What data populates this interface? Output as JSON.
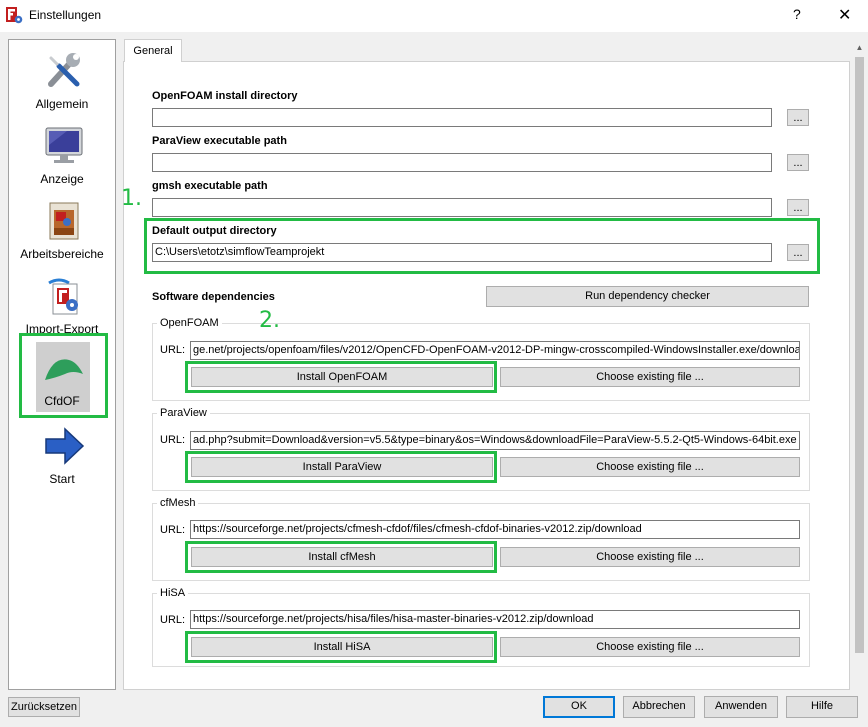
{
  "window": {
    "title": "Einstellungen",
    "help_glyph": "?",
    "close_glyph": "✕"
  },
  "sidebar": {
    "items": [
      {
        "label": "Allgemein",
        "icon": "wrench-screwdriver-icon"
      },
      {
        "label": "Anzeige",
        "icon": "monitor-icon"
      },
      {
        "label": "Arbeitsbereiche",
        "icon": "workbench-box-icon"
      },
      {
        "label": "Import-Export",
        "icon": "import-export-icon"
      },
      {
        "label": "CfdOF",
        "icon": "cfdof-leaf-icon",
        "selected": true
      },
      {
        "label": "Start",
        "icon": "start-arrow-icon"
      }
    ]
  },
  "annotations": {
    "marker_1": "1.",
    "marker_2": "2.",
    "highlight_color": "#22bb44"
  },
  "tabs": [
    {
      "label": "General",
      "active": true
    }
  ],
  "general": {
    "openfoam_dir": {
      "label": "OpenFOAM install directory",
      "value": "",
      "browse": "..."
    },
    "paraview_path": {
      "label": "ParaView executable path",
      "value": "",
      "browse": "..."
    },
    "gmsh_path": {
      "label": "gmsh executable path",
      "value": "",
      "browse": "..."
    },
    "output_dir": {
      "label": "Default output directory",
      "value": "C:\\Users\\etotz\\simflowTeamprojekt",
      "browse": "..."
    },
    "software_deps": {
      "label": "Software dependencies",
      "checker_button": "Run dependency checker"
    }
  },
  "groups": {
    "openfoam": {
      "title": "OpenFOAM",
      "url_label": "URL:",
      "url": "ge.net/projects/openfoam/files/v2012/OpenCFD-OpenFOAM-v2012-DP-mingw-crosscompiled-WindowsInstaller.exe/download",
      "install_button": "Install OpenFOAM",
      "choose_button": "Choose existing file ..."
    },
    "paraview": {
      "title": "ParaView",
      "url_label": "URL:",
      "url": "ad.php?submit=Download&version=v5.5&type=binary&os=Windows&downloadFile=ParaView-5.5.2-Qt5-Windows-64bit.exe",
      "install_button": "Install ParaView",
      "choose_button": "Choose existing file ..."
    },
    "cfmesh": {
      "title": "cfMesh",
      "url_label": "URL:",
      "url": "https://sourceforge.net/projects/cfmesh-cfdof/files/cfmesh-cfdof-binaries-v2012.zip/download",
      "install_button": "Install cfMesh",
      "choose_button": "Choose existing file ..."
    },
    "hisa": {
      "title": "HiSA",
      "url_label": "URL:",
      "url": "https://sourceforge.net/projects/hisa/files/hisa-master-binaries-v2012.zip/download",
      "install_button": "Install HiSA",
      "choose_button": "Choose existing file ..."
    }
  },
  "footer": {
    "reset": "Zurücksetzen",
    "ok": "OK",
    "cancel": "Abbrechen",
    "apply": "Anwenden",
    "help": "Hilfe"
  }
}
